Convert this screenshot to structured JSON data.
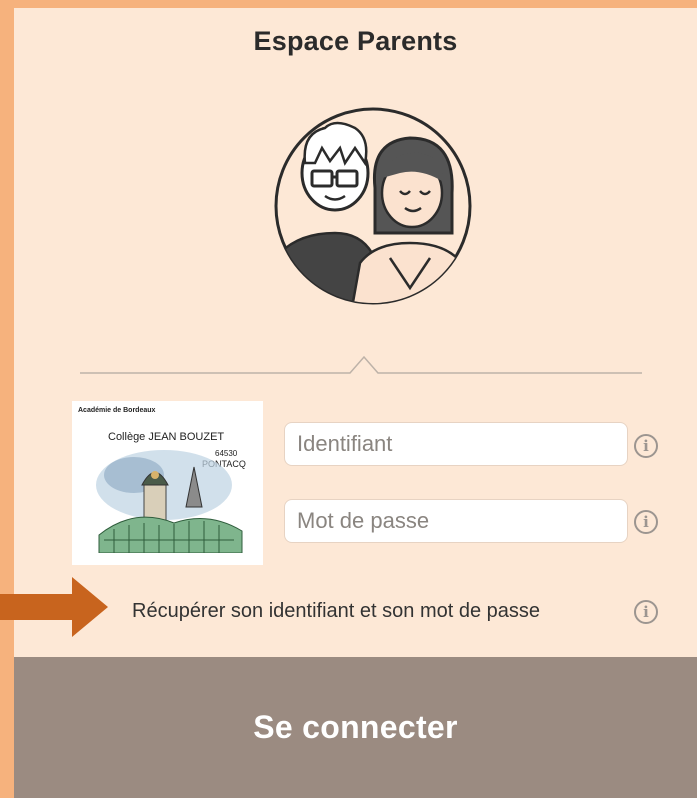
{
  "page": {
    "title": "Espace Parents"
  },
  "school_logo": {
    "academy": "Académie de Bordeaux",
    "name": "Collège JEAN BOUZET",
    "postcode": "64530",
    "town": "PONTACQ"
  },
  "login": {
    "identifier_placeholder": "Identifiant",
    "password_placeholder": "Mot de passe",
    "recover_label": "Récupérer son identifiant et son mot de passe",
    "submit_label": "Se connecter"
  },
  "icons": {
    "info": "info-icon",
    "avatar": "parents-avatar-icon",
    "arrow": "arrow-right-icon"
  },
  "colors": {
    "background": "#f6b27d",
    "panel": "#fde8d6",
    "button": "#9b8b81",
    "arrow": "#c8641e"
  }
}
